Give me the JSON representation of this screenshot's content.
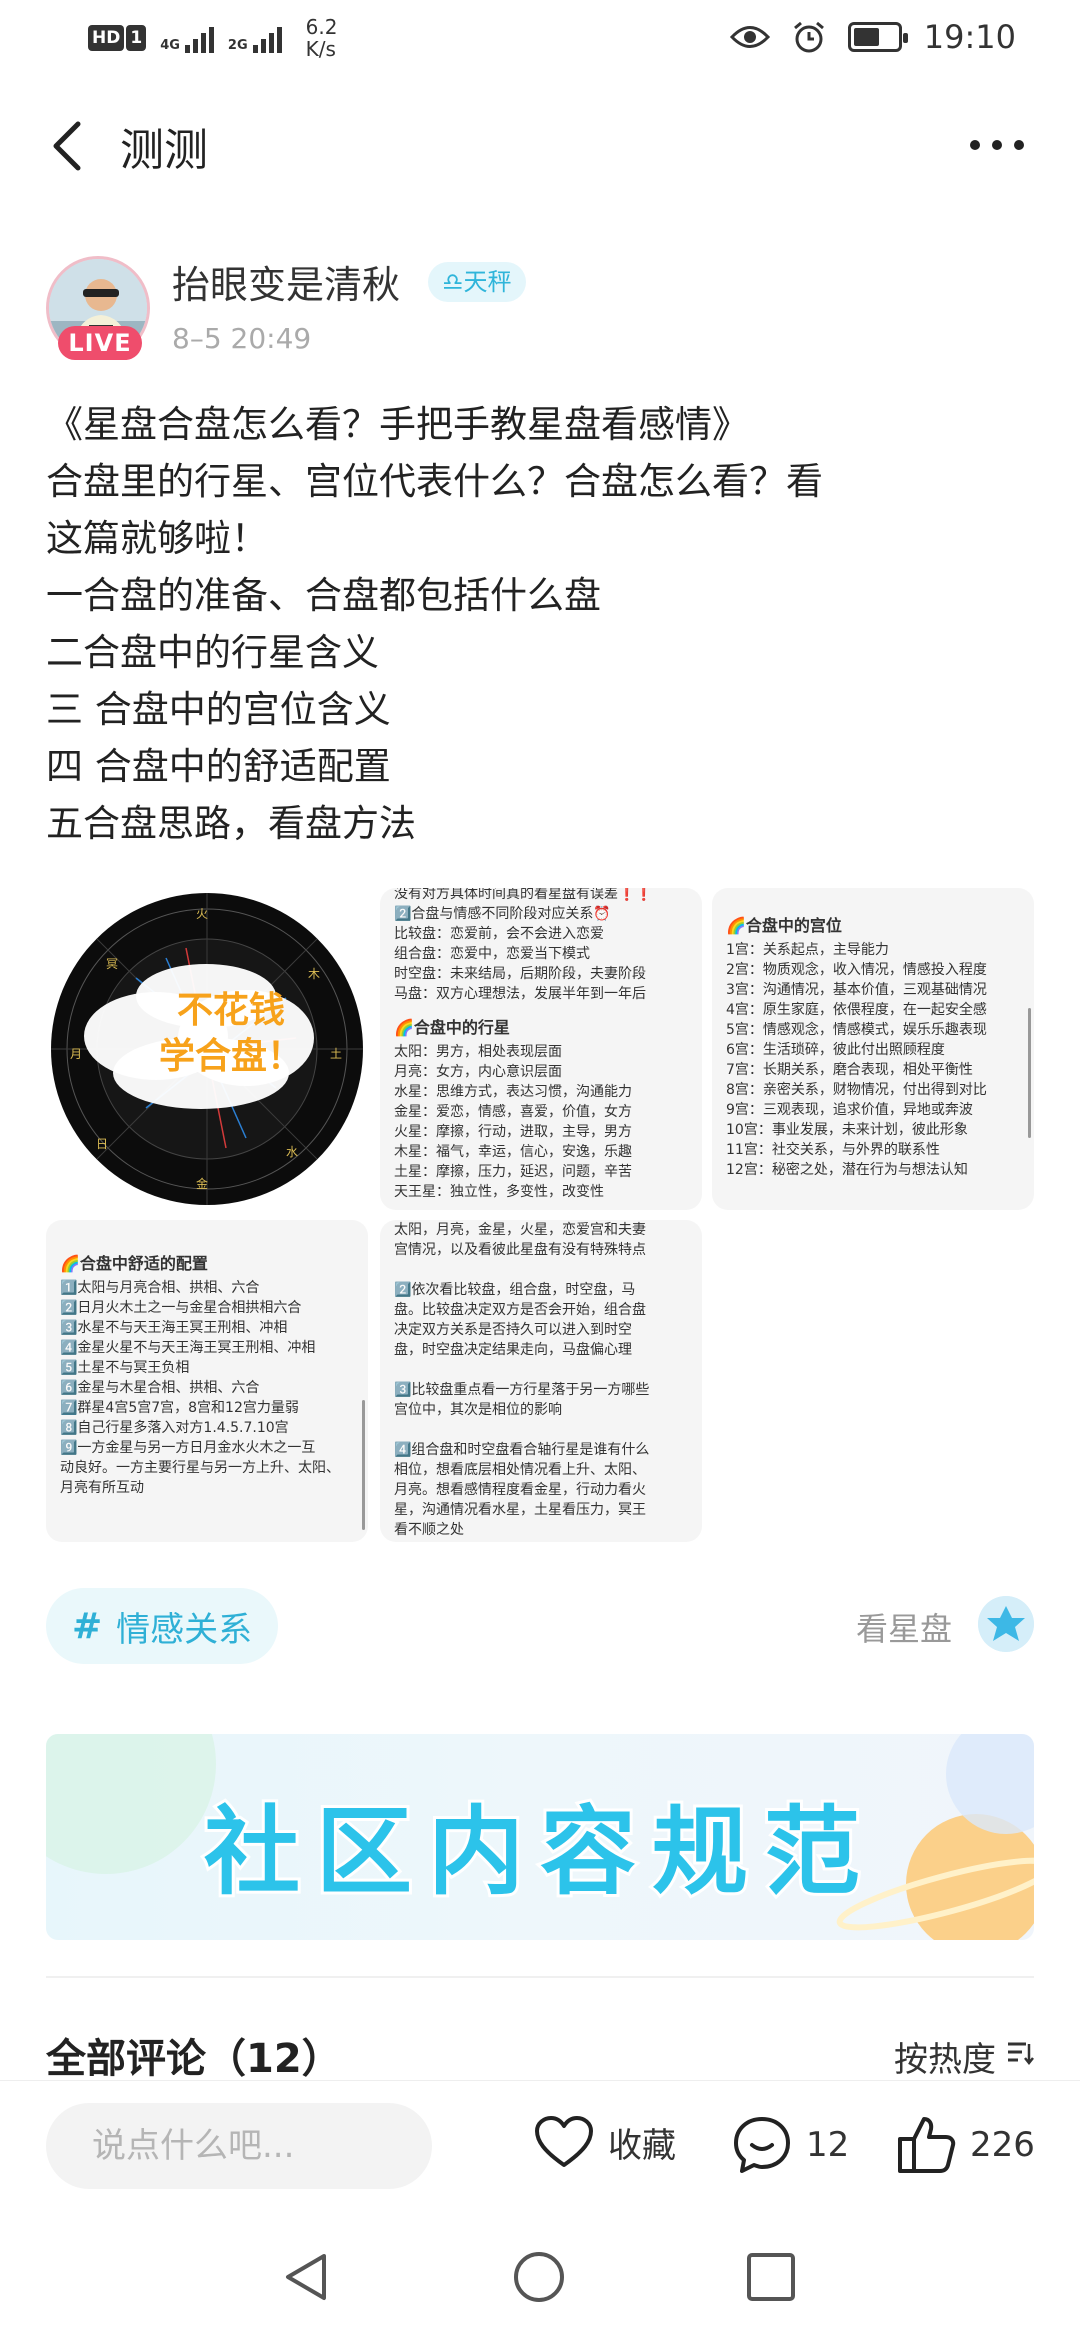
{
  "status_bar": {
    "network_1": "4G",
    "network_2": "2G",
    "speed": "6.2",
    "speed_unit": "K/s",
    "time": "19:10",
    "battery_level": 0.6
  },
  "header": {
    "back_icon": "chevron-left-icon",
    "title": "测测",
    "more_icon": "more-dots-icon"
  },
  "post": {
    "author": "抬眼变是清秋",
    "live_badge": "LIVE",
    "zodiac": "♎天秤",
    "date": "8–5 20:49",
    "lines": [
      "《星盘合盘怎么看？手把手教星盘看感情》",
      "合盘里的行星、宫位代表什么？合盘怎么看？看",
      "这篇就够啦！",
      "一合盘的准备、合盘都包括什么盘",
      "二合盘中的行星含义",
      "三 合盘中的宫位含义",
      "四 合盘中的舒适配置",
      "五合盘思路，看盘方法"
    ]
  },
  "images": {
    "chart_cell": {
      "overlay_line1": "不花钱",
      "overlay_line2": "学合盘！"
    },
    "cell2": {
      "top": "没有对方具体时间真的看星盘有误差❗❗",
      "heading1": "2️⃣合盘与情感不同阶段对应关系⏰",
      "rows1": [
        "比较盘：恋爱前，会不会进入恋爱",
        "组合盘：恋爱中，恋爱当下模式",
        "时空盘：未来结局，后期阶段，夫妻阶段",
        "马盘：双方心理想法，发展半年到一年后"
      ],
      "heading2": "🌈合盘中的行星",
      "rows2": [
        "太阳：男方，相处表现层面",
        "月亮：女方，内心意识层面",
        "水星：思维方式，表达习惯，沟通能力",
        "金星：爱恋，情感，喜爱，价值，女方",
        "火星：摩擦，行动，进取，主导，男方",
        "木星：福气，幸运，信心，安逸，乐趣",
        "土星：摩擦，压力，延迟，问题，辛苦",
        "天王星：独立性，多变性，改变性"
      ]
    },
    "cell3": {
      "heading": "🌈合盘中的宫位",
      "rows": [
        "1宫：关系起点，主导能力",
        "2宫：物质观念，收入情况，情感投入程度",
        "3宫：沟通情况，基本价值，三观基础情况",
        "4宫：原生家庭，依偎程度，在一起安全感",
        "5宫：情感观念，情感模式，娱乐乐趣表现",
        "6宫：生活琐碎，彼此付出照顾程度",
        "7宫：长期关系，磨合表现，相处平衡性",
        "8宫：亲密关系，财物情况，付出得到对比",
        "9宫：三观表现，追求价值，异地或奔波",
        "10宫：事业发展，未来计划，彼此形象",
        "11宫：社交关系，与外界的联系性",
        "12宫：秘密之处，潜在行为与想法认知"
      ]
    },
    "cell4": {
      "heading": "🌈合盘中舒适的配置",
      "rows": [
        "1️⃣太阳与月亮合相、拱相、六合",
        "2️⃣日月火木土之一与金星合相拱相六合",
        "3️⃣水星不与天王海王冥王刑相、冲相",
        "4️⃣金星火星不与天王海王冥王刑相、冲相",
        "5️⃣土星不与冥王负相",
        "6️⃣金星与木星合相、拱相、六合",
        "7️⃣群星4宫5宫7宫，8宫和12宫力量弱",
        "8️⃣自己行星多落入对方1.4.5.7.10宫",
        "9️⃣一方金星与另一方日月金水火木之一互",
        "动良好。一方主要行星与另一方上升、太阳、",
        "月亮有所互动"
      ]
    },
    "cell5": {
      "rows": [
        "太阳，月亮，金星，火星，恋爱宫和夫妻",
        "宫情况，以及看彼此星盘有没有特殊特点",
        "",
        "2️⃣依次看比较盘，组合盘，时空盘，马",
        "盘。比较盘决定双方是否会开始，组合盘",
        "决定双方关系是否持久可以进入到时空",
        "盘，时空盘决定结果走向，马盘偏心理",
        "",
        "3️⃣比较盘重点看一方行星落于另一方哪些",
        "宫位中，其次是相位的影响",
        "",
        "4️⃣组合盘和时空盘看合轴行星是谁有什么",
        "相位，想看底层相处情况看上升、太阳、",
        "月亮。想看感情程度看金星，行动力看火",
        "星，沟通情况看水星，土星看压力，冥王",
        "看不顺之处"
      ]
    }
  },
  "tags": {
    "topic_hash": "#",
    "topic": "情感关系",
    "feature": "看星盘",
    "feature_icon": "star-badge-icon"
  },
  "banner": {
    "text": "社区内容规范"
  },
  "comments": {
    "title": "全部评论（12）",
    "sort_label": "按热度",
    "sort_icon": "sort-icon"
  },
  "bottom_bar": {
    "input_placeholder": "说点什么吧...",
    "favorite_label": "收藏",
    "comment_count": "12",
    "like_count": "226"
  },
  "colors": {
    "accent": "#2fb5da",
    "live": "#ef4d6c",
    "overlay_text": "#f7a21b"
  }
}
